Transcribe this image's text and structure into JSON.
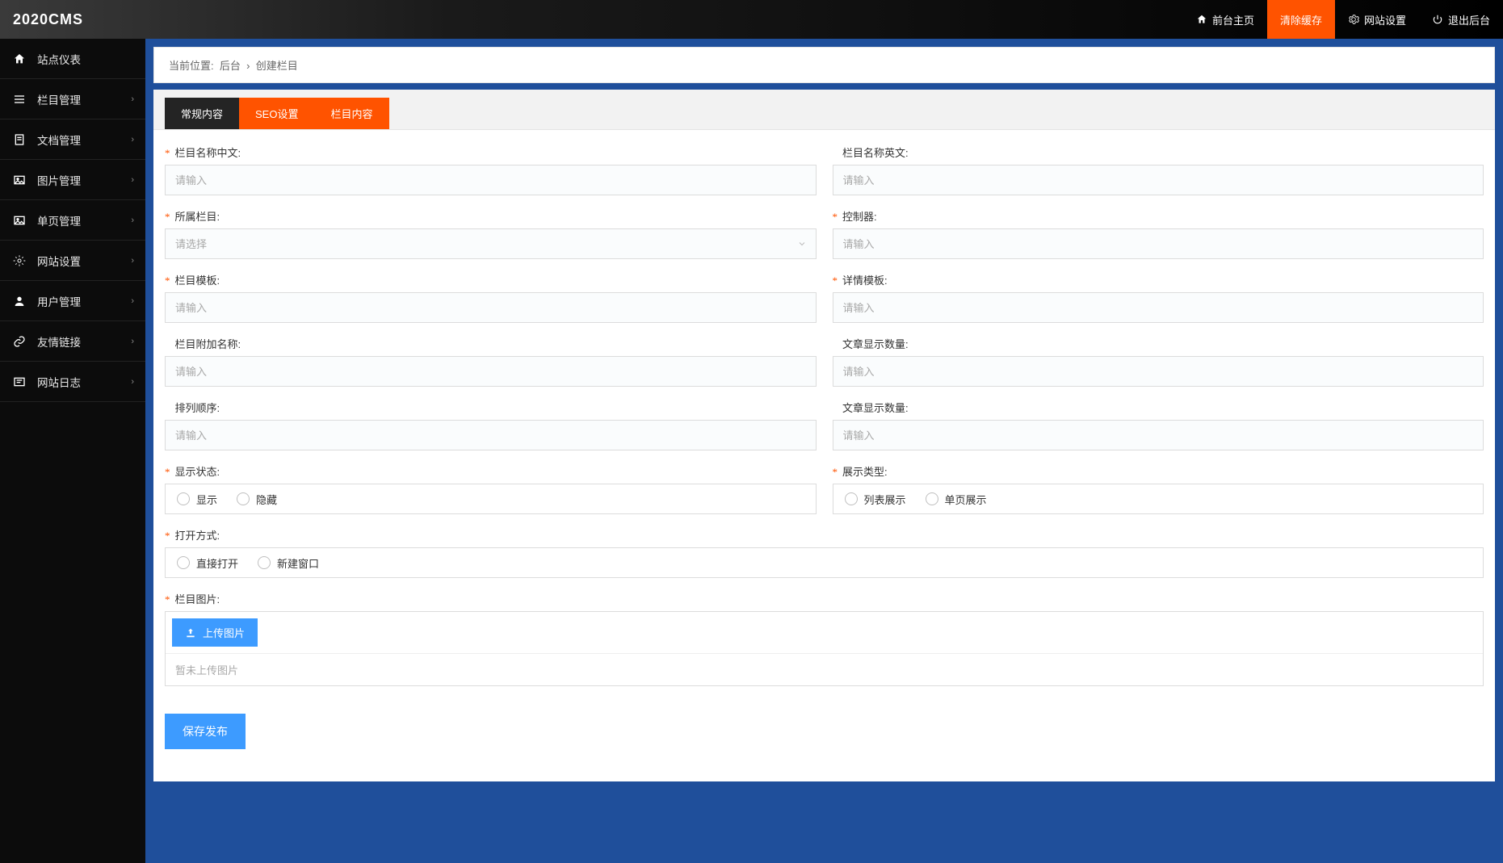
{
  "header": {
    "logo": "2020CMS",
    "links": {
      "home": "前台主页",
      "clear_cache": "清除缓存",
      "site_settings": "网站设置",
      "logout": "退出后台"
    }
  },
  "sidebar": {
    "items": [
      {
        "label": "站点仪表",
        "has_sub": false
      },
      {
        "label": "栏目管理",
        "has_sub": true
      },
      {
        "label": "文档管理",
        "has_sub": true
      },
      {
        "label": "图片管理",
        "has_sub": true
      },
      {
        "label": "单页管理",
        "has_sub": true
      },
      {
        "label": "网站设置",
        "has_sub": true
      },
      {
        "label": "用户管理",
        "has_sub": true
      },
      {
        "label": "友情链接",
        "has_sub": true
      },
      {
        "label": "网站日志",
        "has_sub": true
      }
    ]
  },
  "breadcrumb": {
    "prefix": "当前位置:",
    "backend": "后台",
    "sep": "›",
    "current": "创建栏目"
  },
  "tabs": {
    "general": "常规内容",
    "seo": "SEO设置",
    "content": "栏目内容"
  },
  "form": {
    "name_cn_label": "栏目名称中文:",
    "name_en_label": "栏目名称英文:",
    "parent_label": "所属栏目:",
    "controller_label": "控制器:",
    "column_tpl_label": "栏目模板:",
    "detail_tpl_label": "详情模板:",
    "extra_name_label": "栏目附加名称:",
    "article_count_label_1": "文章显示数量:",
    "sort_label": "排列顺序:",
    "article_count_label_2": "文章显示数量:",
    "display_status_label": "显示状态:",
    "display_type_label": "展示类型:",
    "open_type_label": "打开方式:",
    "image_label": "栏目图片:",
    "placeholder_input": "请输入",
    "placeholder_select": "请选择",
    "radio_show": "显示",
    "radio_hide": "隐藏",
    "radio_list": "列表展示",
    "radio_single": "单页展示",
    "radio_direct": "直接打开",
    "radio_newwin": "新建窗口",
    "upload_btn": "上传图片",
    "upload_empty": "暂未上传图片",
    "submit": "保存发布"
  }
}
